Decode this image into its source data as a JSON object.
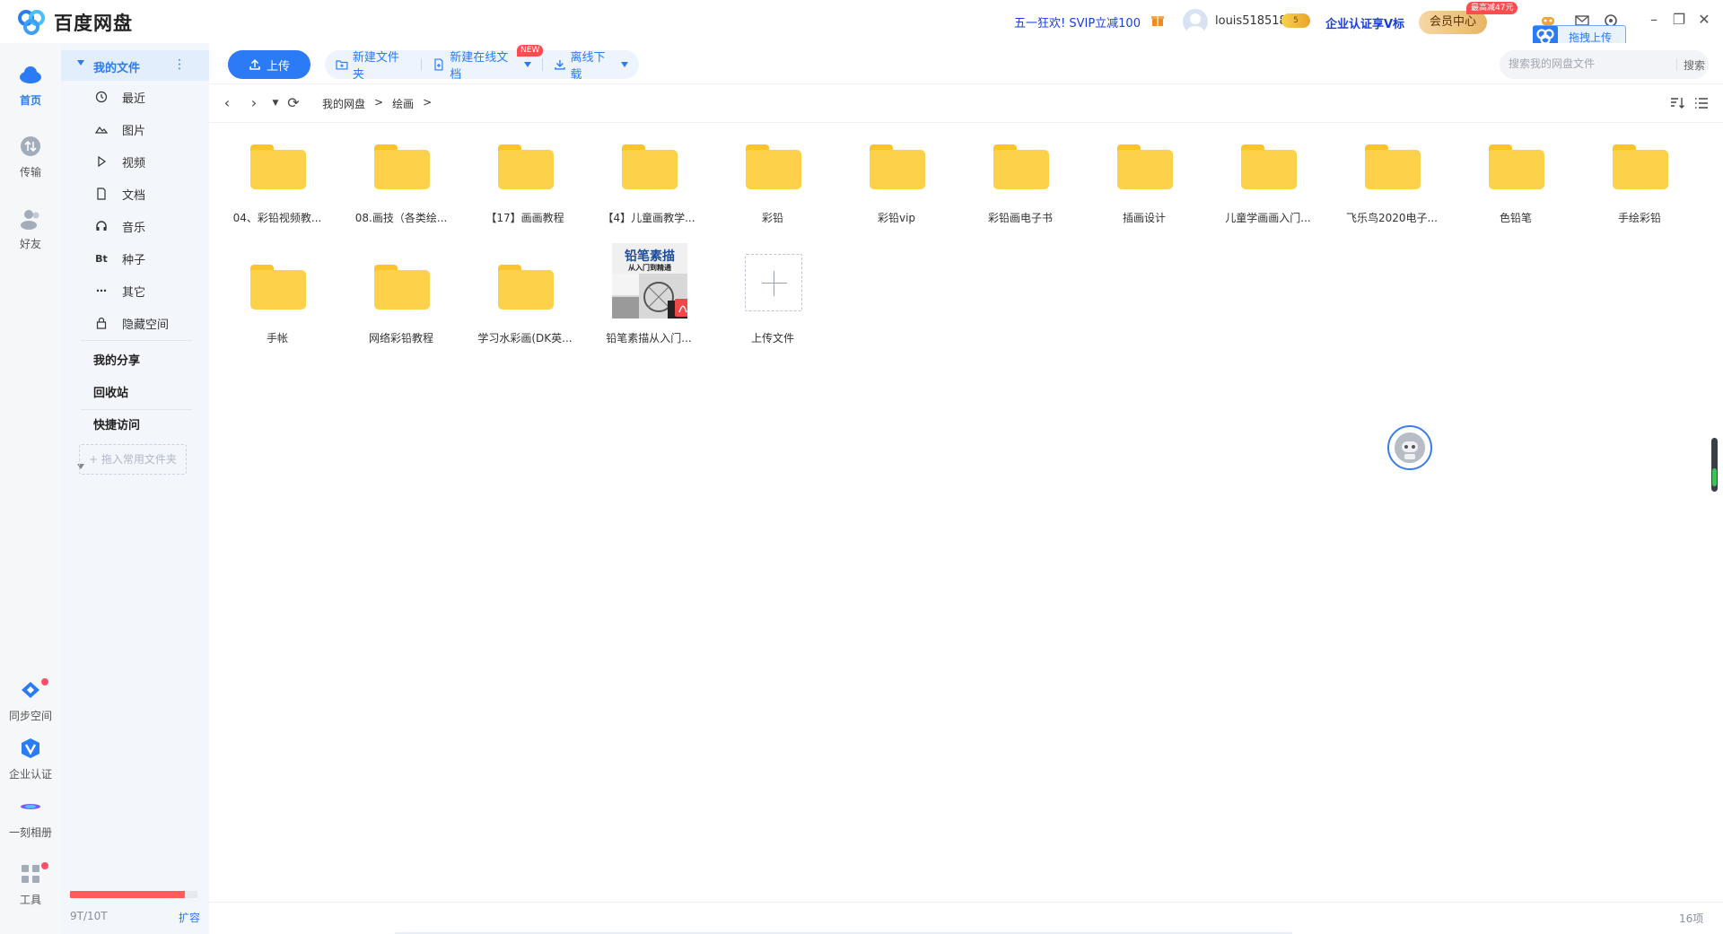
{
  "app": {
    "title": "百度网盘"
  },
  "header": {
    "promo": "五一狂欢! SVIP立减100",
    "username": "louis518518",
    "coin_badge": "5",
    "enterprise_link": "企业认证享V标",
    "vip_button": "会员中心",
    "vip_flag": "最高减47元",
    "drag_upload": "拖拽上传"
  },
  "rail": {
    "items": [
      {
        "label": "首页",
        "icon": "cloud-icon"
      },
      {
        "label": "传输",
        "icon": "transfer-icon"
      },
      {
        "label": "好友",
        "icon": "friends-icon"
      }
    ],
    "bottom": [
      {
        "label": "同步空间",
        "icon": "sync-space-icon"
      },
      {
        "label": "企业认证",
        "icon": "enterprise-v-icon"
      },
      {
        "label": "一刻相册",
        "icon": "album-icon"
      },
      {
        "label": "工具",
        "icon": "tools-icon"
      }
    ]
  },
  "sidebar": {
    "my_files": "我的文件",
    "items": [
      {
        "label": "最近",
        "icon": "clock-icon"
      },
      {
        "label": "图片",
        "icon": "image-icon"
      },
      {
        "label": "视频",
        "icon": "play-icon"
      },
      {
        "label": "文档",
        "icon": "document-icon"
      },
      {
        "label": "音乐",
        "icon": "headphones-icon"
      },
      {
        "label": "种子",
        "icon": "bt-icon"
      },
      {
        "label": "其它",
        "icon": "more-icon"
      },
      {
        "label": "隐藏空间",
        "icon": "lock-icon"
      }
    ],
    "my_share": "我的分享",
    "recycle": "回收站",
    "quick_access": "快捷访问",
    "quick_access_placeholder": "+ 拖入常用文件夹",
    "quota": "9T/10T",
    "quota_fraction": 0.9,
    "expand": "扩容"
  },
  "toolbar": {
    "upload": "上传",
    "new_folder": "新建文件夹",
    "new_online_doc": "新建在线文档",
    "new_badge": "NEW",
    "offline_download": "离线下载",
    "search_placeholder": "搜索我的网盘文件",
    "search_button": "搜索"
  },
  "breadcrumb": {
    "root": "我的网盘",
    "sep1": ">",
    "current": "绘画",
    "sep2": ">"
  },
  "files": [
    {
      "name": "04、彩铅视频教...",
      "type": "folder"
    },
    {
      "name": "08.画技（各类绘...",
      "type": "folder"
    },
    {
      "name": "【17】画画教程",
      "type": "folder"
    },
    {
      "name": "【4】儿童画教学...",
      "type": "folder"
    },
    {
      "name": "彩铅",
      "type": "folder"
    },
    {
      "name": "彩铅vip",
      "type": "folder"
    },
    {
      "name": "彩铅画电子书",
      "type": "folder"
    },
    {
      "name": "插画设计",
      "type": "folder"
    },
    {
      "name": "儿童学画画入门...",
      "type": "folder"
    },
    {
      "name": "飞乐鸟2020电子...",
      "type": "folder"
    },
    {
      "name": "色铅笔",
      "type": "folder"
    },
    {
      "name": "手绘彩铅",
      "type": "folder"
    },
    {
      "name": "手帐",
      "type": "folder"
    },
    {
      "name": "网络彩铅教程",
      "type": "folder"
    },
    {
      "name": "学习水彩画(DK英...",
      "type": "folder"
    },
    {
      "name": "铅笔素描从入门...",
      "type": "pdf",
      "thumb_title": "铅笔素描",
      "thumb_sub": "从入门到精通"
    },
    {
      "name": "上传文件",
      "type": "upload"
    }
  ],
  "status": {
    "count": "16项"
  },
  "colors": {
    "accent": "#2a7bf5",
    "folder": "#fdd24a",
    "quota": "#ff5c5c"
  }
}
